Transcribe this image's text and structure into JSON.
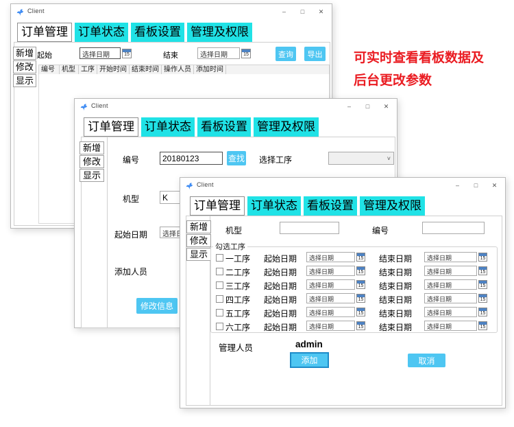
{
  "shared": {
    "window_title": "Client",
    "tabs": [
      {
        "label": "订单管理",
        "selected": true
      },
      {
        "label": "订单状态",
        "selected": false
      },
      {
        "label": "看板设置",
        "selected": false
      },
      {
        "label": "管理及权限",
        "selected": false
      }
    ],
    "sidebar": [
      {
        "label": "新增"
      },
      {
        "label": "修改"
      },
      {
        "label": "显示"
      }
    ],
    "date_placeholder": "选择日期",
    "calendar_icon_day": "15",
    "window_controls": {
      "minimize": "–",
      "maximize": "□",
      "close": "✕"
    },
    "icons": {
      "chevron_down": "˅"
    }
  },
  "colors": {
    "tab_cyan": "#20e2e6",
    "button_blue": "#4ec6f2",
    "annotation_red": "#ea1c22",
    "focus_blue": "#1e8bc8"
  },
  "annotation": {
    "line1": "可实时查看看板数据及",
    "line2": "后台更改参数"
  },
  "back_window": {
    "form": {
      "start_label": "起始",
      "end_label": "结束",
      "query_button": "查询",
      "export_button": "导出"
    },
    "table_headers": [
      "编号",
      "机型",
      "工序",
      "开始时间",
      "结束时间",
      "操作人员",
      "添加时间"
    ]
  },
  "middle_window": {
    "form": {
      "order_label": "编号",
      "order_value": "20180123",
      "find_button": "查找",
      "process_label": "选择工序",
      "model_label": "机型",
      "model_value": "K",
      "start_date_label": "起始日期",
      "adder_label": "添加人员",
      "modify_button": "修改信息"
    }
  },
  "front_window": {
    "form": {
      "model_label": "机型",
      "order_label": "编号",
      "group_label": "勾选工序",
      "process_rows": [
        {
          "label": "一工序"
        },
        {
          "label": "二工序"
        },
        {
          "label": "三工序"
        },
        {
          "label": "四工序"
        },
        {
          "label": "五工序"
        },
        {
          "label": "六工序"
        }
      ],
      "row_start_label": "起始日期",
      "row_end_label": "结束日期",
      "admin_label": "管理人员",
      "admin_value": "admin",
      "add_button": "添加",
      "cancel_button": "取消"
    }
  }
}
